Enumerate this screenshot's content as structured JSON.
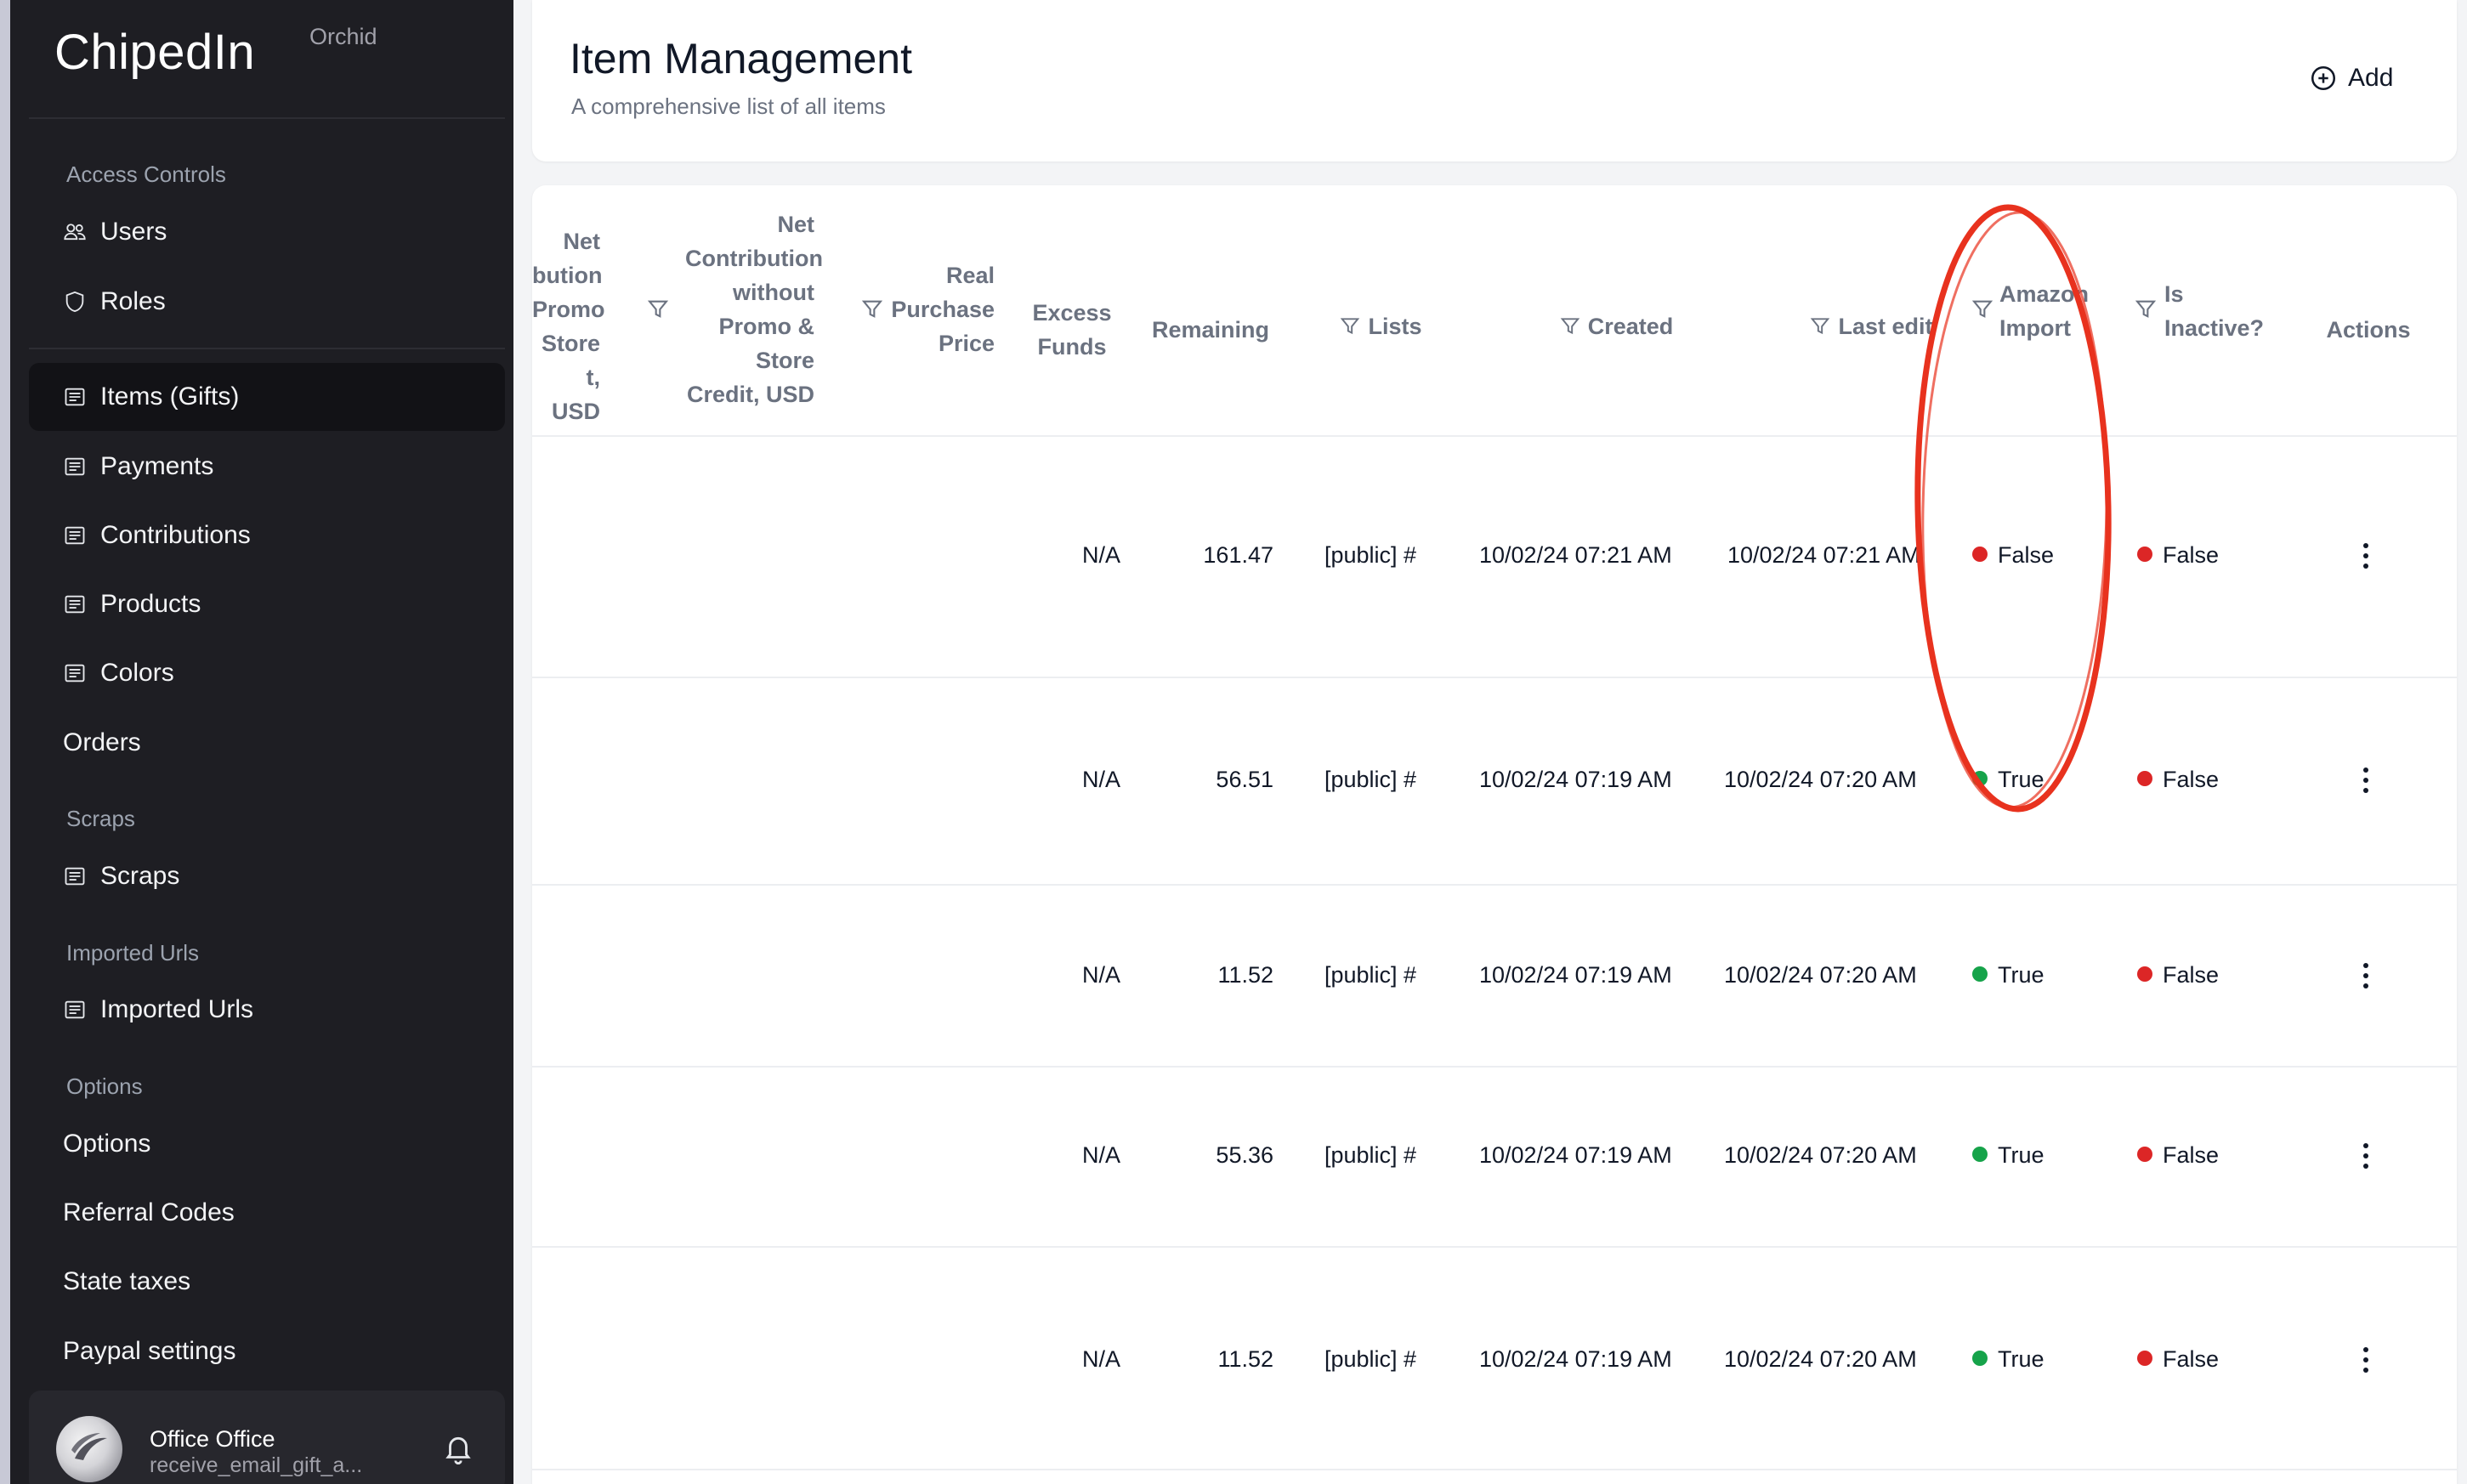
{
  "app": {
    "name": "ChipedIn",
    "edition": "Orchid"
  },
  "sidebar": {
    "sections": {
      "access_controls": "Access Controls",
      "scraps": "Scraps",
      "imported_urls": "Imported Urls",
      "options": "Options"
    },
    "items": {
      "users": "Users",
      "roles": "Roles",
      "items_gifts": "Items (Gifts)",
      "payments": "Payments",
      "contributions": "Contributions",
      "products": "Products",
      "colors": "Colors",
      "orders": "Orders",
      "scraps": "Scraps",
      "imported_urls": "Imported Urls",
      "options": "Options",
      "referral_codes": "Referral Codes",
      "state_taxes": "State taxes",
      "paypal_settings": "Paypal settings"
    },
    "user": {
      "name": "Office Office",
      "email": "receive_email_gift_a..."
    }
  },
  "header": {
    "title": "Item Management",
    "subtitle": "A comprehensive list of all items",
    "add_label": "Add"
  },
  "table": {
    "headers": {
      "net_promo": [
        "Net",
        "bution",
        "Promo",
        "Store",
        "t, USD"
      ],
      "net_without": [
        "Net",
        "Contribution",
        "without",
        "Promo &",
        "Store",
        "Credit, USD"
      ],
      "real_purchase": [
        "Real",
        "Purchase",
        "Price"
      ],
      "excess": [
        "Excess",
        "Funds"
      ],
      "remaining": "Remaining",
      "lists": "Lists",
      "created": "Created",
      "last_edit": "Last edit",
      "amazon_import": [
        "Amazon",
        "Import"
      ],
      "is_inactive": [
        "Is",
        "Inactive?"
      ],
      "actions": "Actions"
    },
    "rows": [
      {
        "excess": "N/A",
        "remaining": "161.47",
        "lists": "[public] #",
        "created": "10/02/24 07:21 AM",
        "last_edit": "10/02/24 07:21 AM",
        "amazon_import": "False",
        "is_inactive": "False"
      },
      {
        "excess": "N/A",
        "remaining": "56.51",
        "lists": "[public] #",
        "created": "10/02/24 07:19 AM",
        "last_edit": "10/02/24 07:20 AM",
        "amazon_import": "True",
        "is_inactive": "False"
      },
      {
        "excess": "N/A",
        "remaining": "11.52",
        "lists": "[public] #",
        "created": "10/02/24 07:19 AM",
        "last_edit": "10/02/24 07:20 AM",
        "amazon_import": "True",
        "is_inactive": "False"
      },
      {
        "excess": "N/A",
        "remaining": "55.36",
        "lists": "[public] #",
        "created": "10/02/24 07:19 AM",
        "last_edit": "10/02/24 07:20 AM",
        "amazon_import": "True",
        "is_inactive": "False"
      },
      {
        "excess": "N/A",
        "remaining": "11.52",
        "lists": "[public] #",
        "created": "10/02/24 07:19 AM",
        "last_edit": "10/02/24 07:20 AM",
        "amazon_import": "True",
        "is_inactive": "False"
      }
    ]
  },
  "colors": {
    "status_true": "#16a34a",
    "status_false": "#dc2626",
    "annotation": "#e8321e"
  },
  "icons": {
    "users": "users-icon",
    "roles": "shield-icon",
    "list": "list-icon",
    "add": "plus-circle-icon",
    "filter": "filter-icon",
    "bell": "bell-icon",
    "kebab": "more-vertical-icon"
  }
}
